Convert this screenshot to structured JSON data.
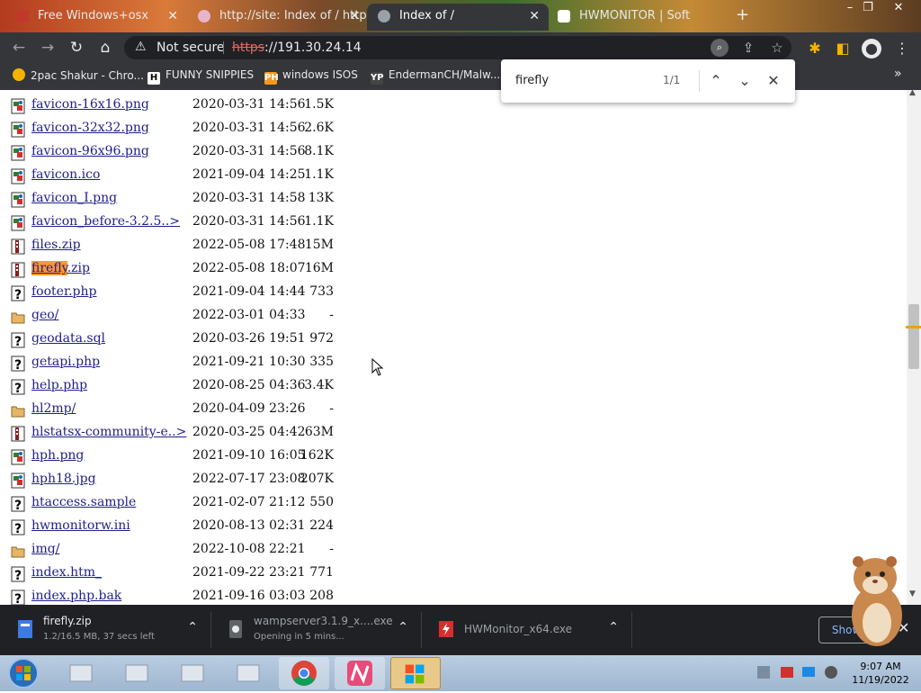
{
  "tabs": [
    {
      "title": "Free Windows+osx",
      "color": "#c0392b"
    },
    {
      "title": "http://site: Index of / http",
      "color": "#e8b4c8"
    },
    {
      "title": "Index of /",
      "color": "#9aa0a6",
      "active": true
    },
    {
      "title": "HWMONITOR | Soft",
      "color": "#ffffff"
    }
  ],
  "toolbar": {
    "security_label": "Not secure",
    "url_scheme": "https",
    "url_rest": "://191.30.24.14"
  },
  "bookmarks": [
    {
      "label": "2pac Shakur - Chro...",
      "icon_text": "",
      "color": "#f4b400"
    },
    {
      "label": "FUNNY SNIPPIES",
      "icon_text": "H",
      "color": "#000000"
    },
    {
      "label": "windows ISOS",
      "icon_text": "PH",
      "color": "#f7971e"
    },
    {
      "label": "EndermanCH/Malw...",
      "icon_text": "YP",
      "color": "#444444"
    }
  ],
  "find": {
    "query": "firefly",
    "count": "1/1"
  },
  "files": [
    {
      "name": "favicon-16x16.png",
      "date": "2020-03-31 14:56",
      "size": "1.5K",
      "type": "image"
    },
    {
      "name": "favicon-32x32.png",
      "date": "2020-03-31 14:56",
      "size": "2.6K",
      "type": "image"
    },
    {
      "name": "favicon-96x96.png",
      "date": "2020-03-31 14:56",
      "size": "8.1K",
      "type": "image"
    },
    {
      "name": "favicon.ico",
      "date": "2021-09-04 14:25",
      "size": "1.1K",
      "type": "image"
    },
    {
      "name": "favicon_I.png",
      "date": "2020-03-31 14:58",
      "size": "13K",
      "type": "image"
    },
    {
      "name": "favicon_before-3.2.5..>",
      "date": "2020-03-31 14:56",
      "size": "1.1K",
      "type": "image"
    },
    {
      "name": "files.zip",
      "date": "2022-05-08 17:48",
      "size": "15M",
      "type": "archive"
    },
    {
      "name_highlight": "firefly",
      "name": ".zip",
      "date": "2022-05-08 18:07",
      "size": "16M",
      "type": "archive"
    },
    {
      "name": "footer.php",
      "date": "2021-09-04 14:44",
      "size": "733",
      "type": "unknown"
    },
    {
      "name": "geo/",
      "date": "2022-03-01 04:33",
      "size": "-",
      "type": "folder"
    },
    {
      "name": "geodata.sql",
      "date": "2020-03-26 19:51",
      "size": "972",
      "type": "unknown"
    },
    {
      "name": "getapi.php",
      "date": "2021-09-21 10:30",
      "size": "335",
      "type": "unknown"
    },
    {
      "name": "help.php",
      "date": "2020-08-25 04:36",
      "size": "3.4K",
      "type": "unknown"
    },
    {
      "name": "hl2mp/",
      "date": "2020-04-09 23:26",
      "size": "-",
      "type": "folder"
    },
    {
      "name": "hlstatsx-community-e..>",
      "date": "2020-03-25 04:42",
      "size": "63M",
      "type": "archive"
    },
    {
      "name": "hph.png",
      "date": "2021-09-10 16:05",
      "size": "162K",
      "type": "image"
    },
    {
      "name": "hph18.jpg",
      "date": "2022-07-17 23:08",
      "size": "207K",
      "type": "image"
    },
    {
      "name": "htaccess.sample",
      "date": "2021-02-07 21:12",
      "size": "550",
      "type": "unknown"
    },
    {
      "name": "hwmonitorw.ini",
      "date": "2020-08-13 02:31",
      "size": "224",
      "type": "unknown"
    },
    {
      "name": "img/",
      "date": "2022-10-08 22:21",
      "size": "-",
      "type": "folder"
    },
    {
      "name": "index.htm_",
      "date": "2021-09-22 23:21",
      "size": "771",
      "type": "unknown"
    },
    {
      "name": "index.php.bak",
      "date": "2021-09-16 03:03",
      "size": "208",
      "type": "unknown"
    }
  ],
  "downloads": [
    {
      "name": "firefly.zip",
      "status": "1.2/16.5 MB, 37 secs left",
      "icon": "zip-file-icon"
    },
    {
      "name": "wampserver3.1.9_x....exe",
      "status": "Opening in 5 mins...",
      "icon": "exe-file-icon"
    },
    {
      "name": "HWMonitor_x64.exe",
      "status": "",
      "icon": "hwmonitor-icon"
    }
  ],
  "shelf": {
    "show_all": "Show all"
  },
  "clock": {
    "time": "9:07 AM",
    "date": "11/19/2022"
  }
}
